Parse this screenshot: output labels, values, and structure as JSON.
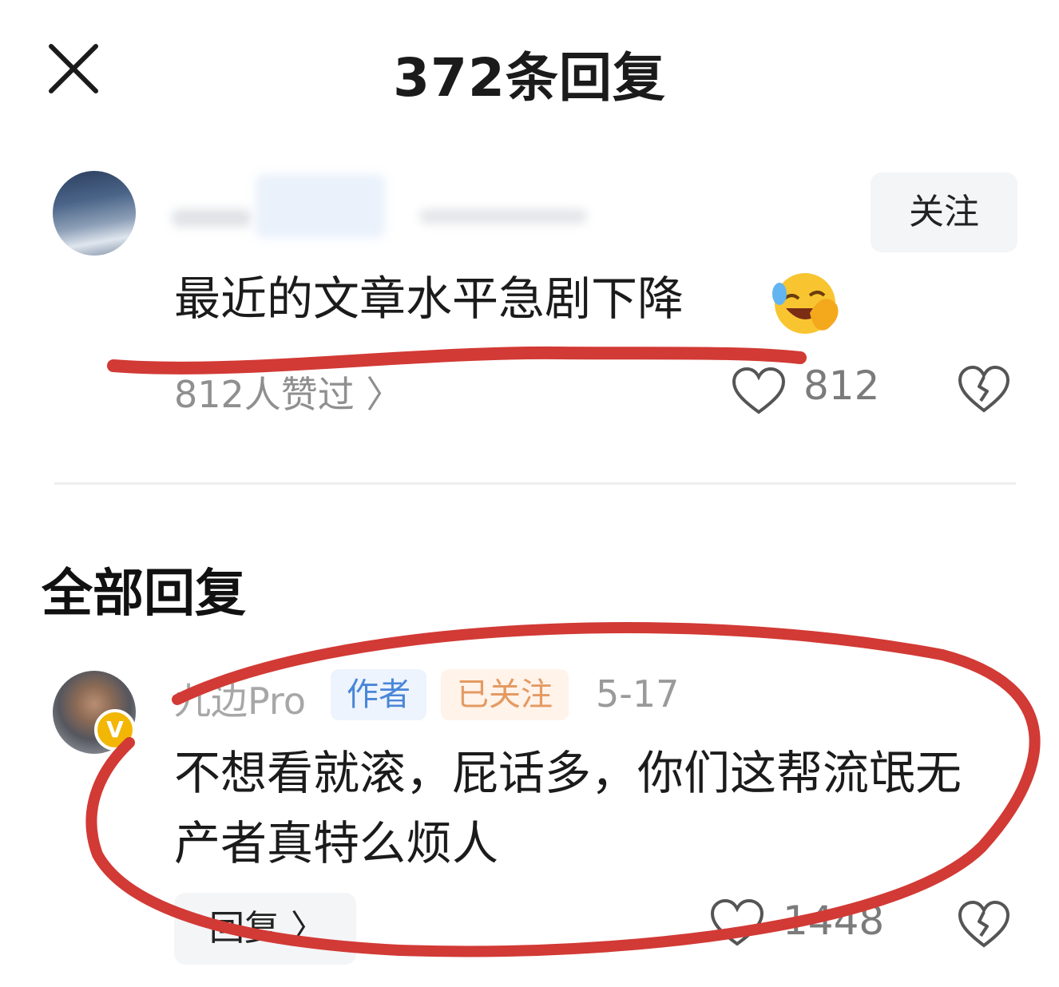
{
  "header": {
    "title": "372条回复"
  },
  "main_comment": {
    "follow_label": "关注",
    "text": "最近的文章水平急剧下降",
    "likes_link": "812人赞过 〉",
    "like_count": "812"
  },
  "section_title": "全部回复",
  "reply": {
    "author_name": "九边Pro",
    "badge_letter": "V",
    "author_tag": "作者",
    "followed_tag": "已关注",
    "date": "5-17",
    "text": "不想看就滚，屁话多，你们这帮流氓无产者真特么烦人",
    "reply_button": "回复 〉",
    "like_count": "1448"
  },
  "colors": {
    "annotation_red": "#d23a35",
    "author_tag": "#4a86d8",
    "followed_tag": "#e49a62"
  }
}
